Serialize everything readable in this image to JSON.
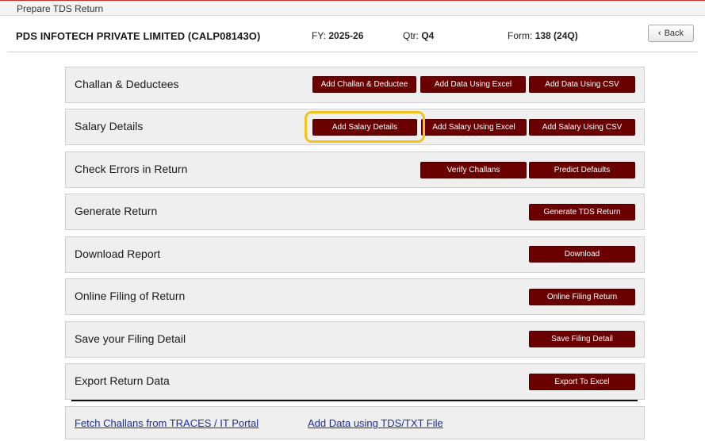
{
  "window": {
    "title": "Prepare TDS Return"
  },
  "header": {
    "company": "PDS INFOTECH PRIVATE LIMITED (CALP08143O)",
    "fy_label": "FY:",
    "fy_value": "2025-26",
    "qtr_label": "Qtr:",
    "qtr_value": "Q4",
    "form_label": "Form:",
    "form_value": "138 (24Q)",
    "back_label": "Back"
  },
  "sections": [
    {
      "label": "Challan & Deductees",
      "buttons": [
        "Add Challan & Deductee",
        "Add Data Using Excel",
        "Add Data Using CSV"
      ]
    },
    {
      "label": "Salary Details",
      "buttons": [
        "Add Salary Details",
        "Add Salary Using Excel",
        "Add Salary Using CSV"
      ]
    },
    {
      "label": "Check Errors in Return",
      "buttons": [
        "Verify Challans",
        "Predict Defaults"
      ]
    },
    {
      "label": "Generate Return",
      "buttons": [
        "Generate TDS Return"
      ]
    },
    {
      "label": "Download Report",
      "buttons": [
        "Download"
      ]
    },
    {
      "label": "Online Filing of Return",
      "buttons": [
        "Online Filing Return"
      ]
    },
    {
      "label": "Save your Filing Detail",
      "buttons": [
        "Save Filing Detail"
      ]
    },
    {
      "label": "Export Return Data",
      "buttons": [
        "Export To Excel"
      ]
    }
  ],
  "footer_links": {
    "fetch_challans": "Fetch Challans from TRACES / IT Portal",
    "add_tds_file": "Add Data using TDS/TXT File"
  },
  "colors": {
    "button": "#6b0000",
    "highlight": "#f0c419",
    "link": "#1a2f9c"
  },
  "icons": {
    "back": "chevron-left-icon"
  }
}
